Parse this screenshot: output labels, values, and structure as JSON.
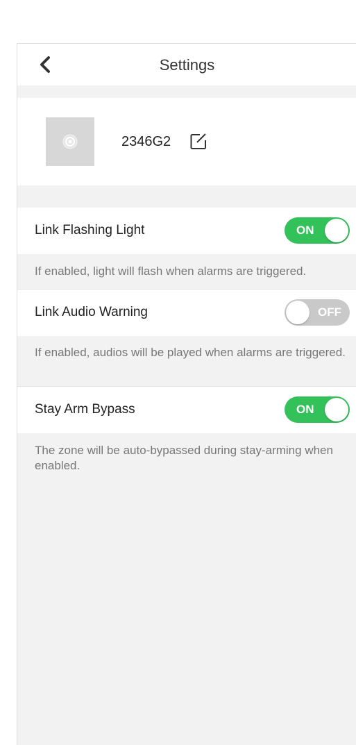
{
  "header": {
    "title": "Settings"
  },
  "device": {
    "name": "2346G2"
  },
  "settings": [
    {
      "label": "Link Flashing Light",
      "state": "ON",
      "enabled": true,
      "description": "If enabled, light will flash when alarms are triggered."
    },
    {
      "label": "Link Audio Warning",
      "state": "OFF",
      "enabled": false,
      "description": "If enabled, audios will be played when alarms are triggered."
    },
    {
      "label": "Stay Arm Bypass",
      "state": "ON",
      "enabled": true,
      "description": "The zone will be auto-bypassed during stay-arming when enabled."
    }
  ],
  "colors": {
    "toggle_on": "#33c15a",
    "toggle_off": "#c9c9c9",
    "background": "#f2f2f2"
  },
  "icons": {
    "back": "chevron-left-icon",
    "edit": "edit-icon",
    "device": "camera-lens-icon"
  }
}
